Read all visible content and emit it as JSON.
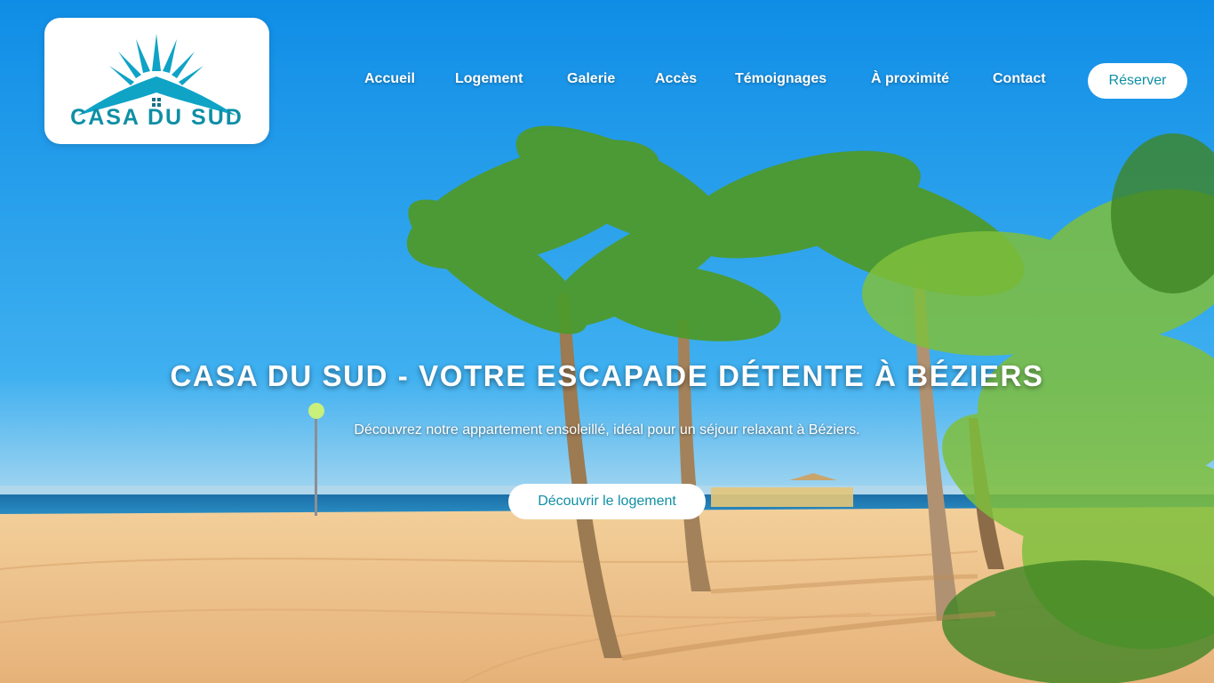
{
  "brand": {
    "name": "CASA DU SUD",
    "accent_color": "#0f8fa5",
    "logo_icon": "sun-house-logo-icon"
  },
  "nav": {
    "items": [
      {
        "label": "Accueil"
      },
      {
        "label": "Logement"
      },
      {
        "label": "Galerie"
      },
      {
        "label": "Accès"
      },
      {
        "label": "Témoignages"
      },
      {
        "label": "À proximité"
      },
      {
        "label": "Contact"
      }
    ],
    "reserve_label": "Réserver"
  },
  "hero": {
    "title": "CASA DU SUD - VOTRE ESCAPADE DÉTENTE À BÉZIERS",
    "subtitle": "Découvrez notre appartement ensoleillé, idéal pour un séjour relaxant à Béziers.",
    "cta_label": "Découvrir le logement",
    "background": "beach-with-palm-trees-image"
  }
}
